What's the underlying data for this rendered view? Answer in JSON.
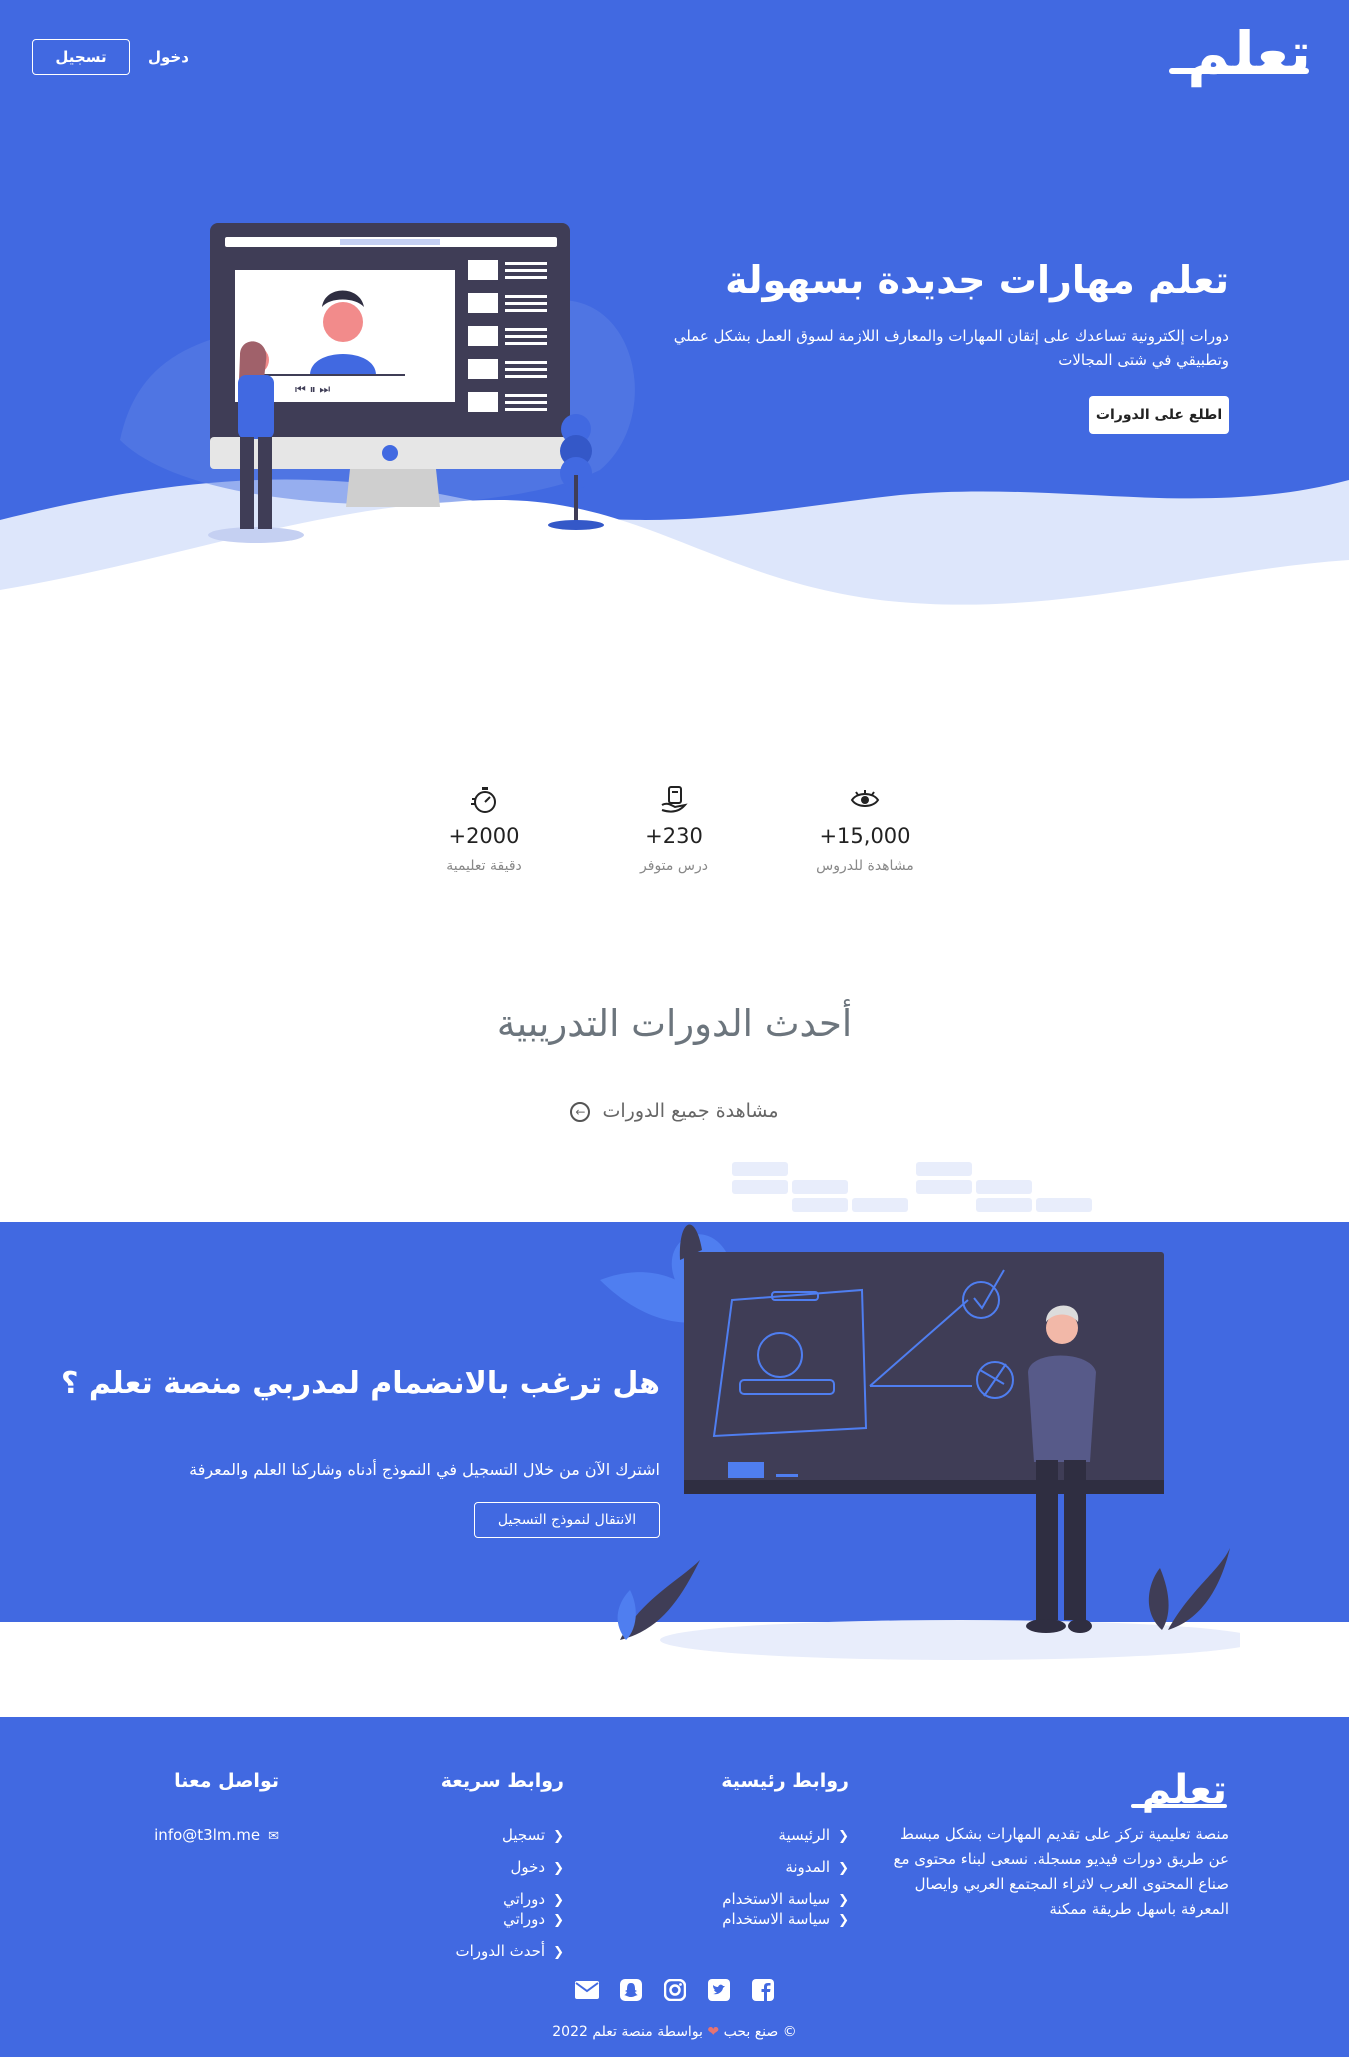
{
  "header": {
    "logo": "تعلم",
    "register_label": "تسجيل",
    "login_label": "دخول"
  },
  "hero": {
    "title": "تعلم مهارات جديدة بسهولة",
    "description": "دورات إلكترونية تساعدك على إتقان المهارات والمعارف اللازمة لسوق العمل بشكل عملي وتطبيقي في شتى المجالات",
    "cta_label": "اطلع على الدورات"
  },
  "stats": [
    {
      "icon": "eye-icon",
      "value": "+15,000",
      "label": "مشاهدة للدروس"
    },
    {
      "icon": "lesson-hand-icon",
      "value": "+230",
      "label": "درس متوفر"
    },
    {
      "icon": "stopwatch-icon",
      "value": "+2000",
      "label": "دقيقة تعليمية"
    }
  ],
  "latest": {
    "title": "أحدث الدورات التدريبية",
    "view_all": "مشاهدة جميع الدورات"
  },
  "join": {
    "title": "هل ترغب بالانضمام لمدربي منصة تعلم ؟",
    "description": "اشترك الآن من خلال التسجيل في النموذج أدناه وشاركنا العلم والمعرفة",
    "cta_label": "الانتقال لنموذج التسجيل"
  },
  "footer": {
    "logo": "تعلم",
    "about": "منصة تعليمية تركز على تقديم المهارات بشكل مبسط عن طريق دورات فيديو مسجلة. نسعى لبناء محتوى مع صناع المحتوى العرب لاثراء المجتمع العربي وايصال المعرفة باسهل طريقة ممكنة",
    "main_links": {
      "title": "روابط رئيسية",
      "items": [
        "الرئيسية",
        "المدونة",
        "سياسة الاستخدام",
        "سياسة الاستخدام"
      ]
    },
    "quick_links": {
      "title": "روابط سريعة",
      "items": [
        "تسجيل",
        "دخول",
        "دوراتي",
        "دوراتي",
        "أحدث الدورات"
      ]
    },
    "contact": {
      "title": "تواصل معنا",
      "email": "info@t3lm.me"
    },
    "socials": [
      "facebook-icon",
      "twitter-icon",
      "instagram-icon",
      "snapchat-icon",
      "mail-icon"
    ],
    "copyright_prefix": "© صنع بحب",
    "copyright_suffix": "بواسطة منصة تعلم 2022"
  },
  "colors": {
    "primary": "#4169e1",
    "dark_screen": "#3f3d56",
    "heart": "#e57373"
  }
}
